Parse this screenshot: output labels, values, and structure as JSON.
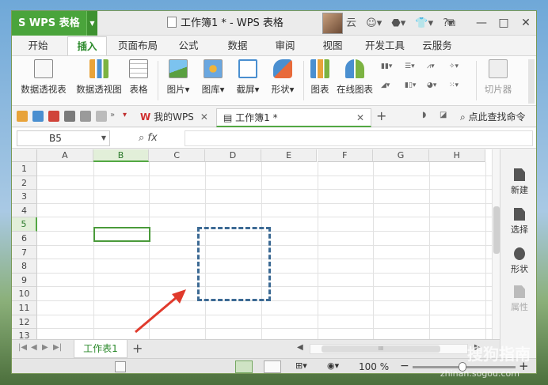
{
  "app": {
    "name": "WPS 表格",
    "doc_title": "工作簿1 * - WPS 表格",
    "user": "云"
  },
  "menu": {
    "tabs": [
      "开始",
      "插入",
      "页面布局",
      "公式",
      "数据",
      "审阅",
      "视图",
      "开发工具",
      "云服务"
    ],
    "active": "插入"
  },
  "ribbon": {
    "pivot_table": "数据透视表",
    "pivot_chart": "数据透视图",
    "table": "表格",
    "picture": "图片",
    "gallery": "图库",
    "screenshot": "截屏",
    "shape": "形状",
    "chart": "图表",
    "online_chart": "在线图表",
    "slicer": "切片器"
  },
  "quickbar": {
    "wps_tab": "我的WPS",
    "doc_tab": "工作簿1 *",
    "search": "点此查找命令"
  },
  "formula": {
    "cell_ref": "B5",
    "fx": "fx",
    "content": ""
  },
  "grid": {
    "columns": [
      "A",
      "B",
      "C",
      "D",
      "E",
      "F",
      "G",
      "H"
    ],
    "rows": [
      "1",
      "2",
      "3",
      "4",
      "5",
      "6",
      "7",
      "8",
      "9",
      "10",
      "11",
      "12",
      "13"
    ],
    "selected_column": "B",
    "selected_row": "5"
  },
  "sidebar": {
    "new": "新建",
    "select": "选择",
    "shape": "形状",
    "property": "属性"
  },
  "sheets": {
    "tab": "工作表1"
  },
  "status": {
    "zoom": "100 %"
  },
  "watermark": {
    "brand": "搜狗指南",
    "url": "zhinan.sogou.com"
  },
  "colors": {
    "accent": "#4aa43b",
    "annotation": "#3c6a94",
    "arrow": "#e03a2c"
  }
}
